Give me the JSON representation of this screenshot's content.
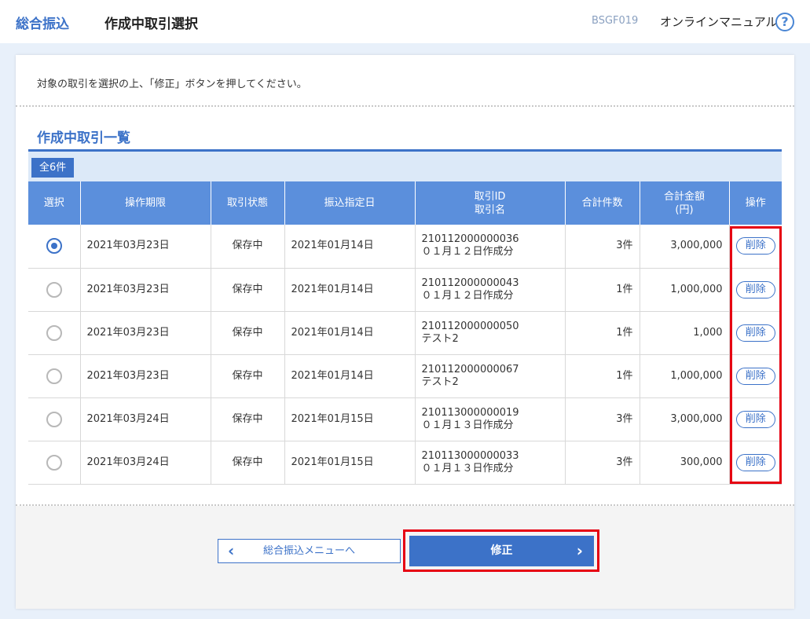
{
  "header": {
    "breadcrumb": "総合振込",
    "title": "作成中取引選択",
    "screen_id": "BSGF019",
    "manual_label": "オンラインマニュアル",
    "help_icon": "?"
  },
  "instruction": "対象の取引を選択の上、「修正」ボタンを押してください。",
  "section": {
    "title": "作成中取引一覧",
    "count_label": "全6件"
  },
  "table": {
    "headers": {
      "select": "選択",
      "deadline": "操作期限",
      "status": "取引状態",
      "transfer_date": "振込指定日",
      "id_line1": "取引ID",
      "id_line2": "取引名",
      "count": "合計件数",
      "amount_line1": "合計金額",
      "amount_line2": "(円)",
      "ops": "操作"
    },
    "delete_label": "削除",
    "rows": [
      {
        "selected": true,
        "deadline": "2021年03月23日",
        "status": "保存中",
        "transfer_date": "2021年01月14日",
        "id": "210112000000036",
        "name": "０１月１２日作成分",
        "count": "3件",
        "amount": "3,000,000"
      },
      {
        "selected": false,
        "deadline": "2021年03月23日",
        "status": "保存中",
        "transfer_date": "2021年01月14日",
        "id": "210112000000043",
        "name": "０１月１２日作成分",
        "count": "1件",
        "amount": "1,000,000"
      },
      {
        "selected": false,
        "deadline": "2021年03月23日",
        "status": "保存中",
        "transfer_date": "2021年01月14日",
        "id": "210112000000050",
        "name": "テスト2",
        "count": "1件",
        "amount": "1,000"
      },
      {
        "selected": false,
        "deadline": "2021年03月23日",
        "status": "保存中",
        "transfer_date": "2021年01月14日",
        "id": "210112000000067",
        "name": "テスト2",
        "count": "1件",
        "amount": "1,000,000"
      },
      {
        "selected": false,
        "deadline": "2021年03月24日",
        "status": "保存中",
        "transfer_date": "2021年01月15日",
        "id": "210113000000019",
        "name": "０１月１３日作成分",
        "count": "3件",
        "amount": "3,000,000"
      },
      {
        "selected": false,
        "deadline": "2021年03月24日",
        "status": "保存中",
        "transfer_date": "2021年01月15日",
        "id": "210113000000033",
        "name": "０１月１３日作成分",
        "count": "3件",
        "amount": "300,000"
      }
    ]
  },
  "buttons": {
    "back": "総合振込メニューへ",
    "modify": "修正"
  },
  "colors": {
    "accent": "#3c72c8",
    "header_bg": "#5b8fdc",
    "highlight": "#e60012"
  }
}
